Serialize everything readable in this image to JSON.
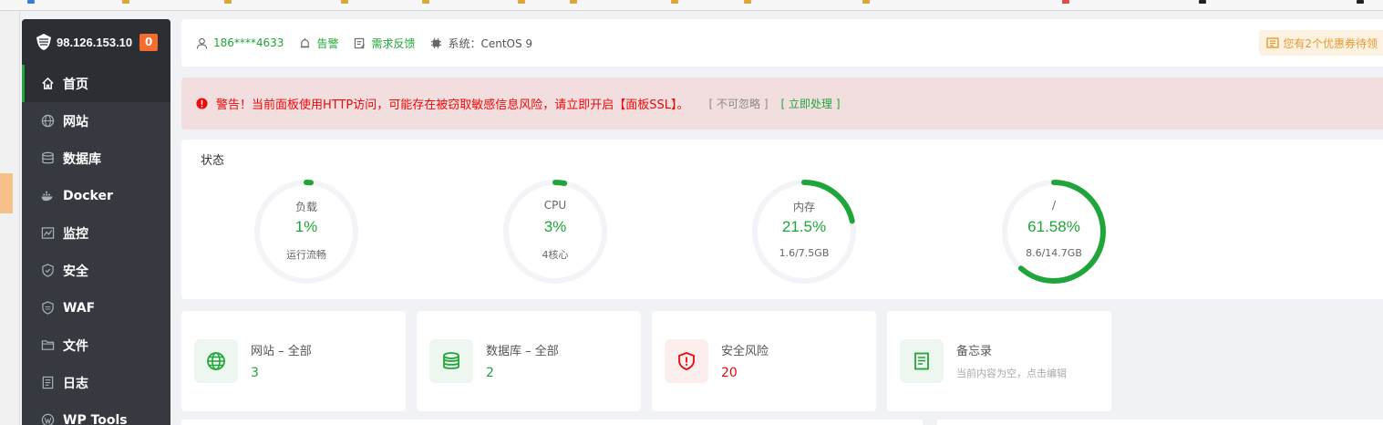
{
  "sidebar": {
    "ip": "98.126.153.10",
    "badge": "0",
    "items": [
      {
        "label": "首页",
        "icon": "home-icon"
      },
      {
        "label": "网站",
        "icon": "globe-icon"
      },
      {
        "label": "数据库",
        "icon": "database-icon"
      },
      {
        "label": "Docker",
        "icon": "docker-icon"
      },
      {
        "label": "监控",
        "icon": "monitor-icon"
      },
      {
        "label": "安全",
        "icon": "shield-icon"
      },
      {
        "label": "WAF",
        "icon": "waf-icon"
      },
      {
        "label": "文件",
        "icon": "folder-icon"
      },
      {
        "label": "日志",
        "icon": "log-icon"
      },
      {
        "label": "WP Tools",
        "icon": "wordpress-icon"
      }
    ]
  },
  "header": {
    "user": "186****4633",
    "alarm": "告警",
    "feedback": "需求反馈",
    "system": "系统：CentOS 9",
    "coupon": "您有2个优惠券待领"
  },
  "alert": {
    "message": "警告！当前面板使用HTTP访问，可能存在被窃取敏感信息风险，请立即开启【面板SSL】。",
    "ignore": "[ 不可忽略 ]",
    "fix": "[ 立即处理 ]"
  },
  "status": {
    "title": "状态",
    "gauges": [
      {
        "label": "负载",
        "value": "1%",
        "sub": "运行流畅",
        "percent": 1
      },
      {
        "label": "CPU",
        "value": "3%",
        "sub": "4核心",
        "percent": 3
      },
      {
        "label": "内存",
        "value": "21.5%",
        "sub": "1.6/7.5GB",
        "percent": 21.5
      },
      {
        "label": "/",
        "value": "61.58%",
        "sub": "8.6/14.7GB",
        "percent": 61.58
      }
    ]
  },
  "cards": [
    {
      "title": "网站 – 全部",
      "value": "3"
    },
    {
      "title": "数据库 – 全部",
      "value": "2"
    },
    {
      "title": "安全风险",
      "value": "20"
    },
    {
      "title": "备忘录",
      "sub": "当前内容为空，点击编辑"
    }
  ],
  "colors": {
    "accent": "#20a53a",
    "danger": "#ef0808",
    "sidebar": "#363a40",
    "warning": "#e69b31"
  }
}
